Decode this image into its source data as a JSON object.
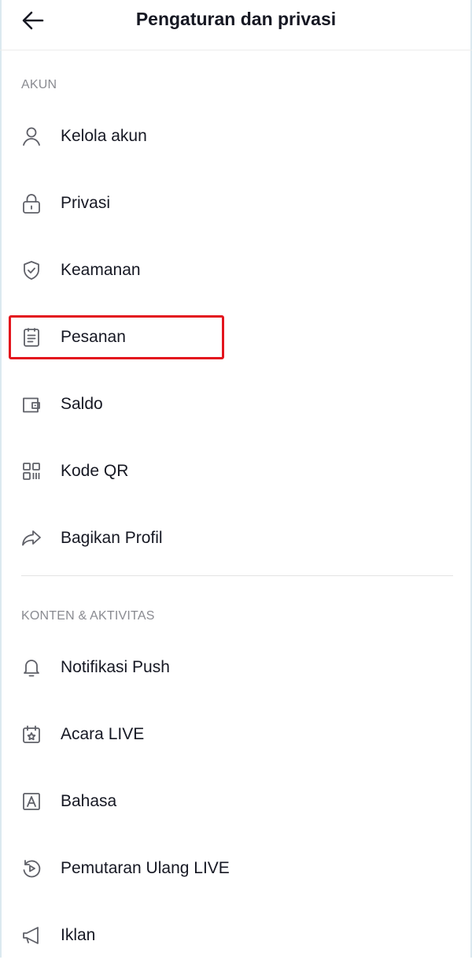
{
  "header": {
    "back_icon": "arrow-left-icon",
    "title": "Pengaturan dan privasi"
  },
  "sections": [
    {
      "label": "AKUN",
      "items": [
        {
          "label": "Kelola akun",
          "icon": "user-icon"
        },
        {
          "label": "Privasi",
          "icon": "lock-icon"
        },
        {
          "label": "Keamanan",
          "icon": "shield-check-icon"
        },
        {
          "label": "Pesanan",
          "icon": "clipboard-list-icon"
        },
        {
          "label": "Saldo",
          "icon": "wallet-icon"
        },
        {
          "label": "Kode QR",
          "icon": "qr-code-icon"
        },
        {
          "label": "Bagikan Profil",
          "icon": "share-arrow-icon"
        }
      ]
    },
    {
      "label": "KONTEN & AKTIVITAS",
      "items": [
        {
          "label": "Notifikasi Push",
          "icon": "bell-icon"
        },
        {
          "label": "Acara LIVE",
          "icon": "calendar-star-icon"
        },
        {
          "label": "Bahasa",
          "icon": "language-a-icon"
        },
        {
          "label": "Pemutaran Ulang LIVE",
          "icon": "replay-icon"
        },
        {
          "label": "Iklan",
          "icon": "megaphone-icon"
        }
      ]
    }
  ],
  "highlight": {
    "item": "Pesanan",
    "color": "#e3141d"
  },
  "colors": {
    "text": "#161823",
    "section_label": "#8a8b91",
    "divider": "#e3e3e4"
  }
}
